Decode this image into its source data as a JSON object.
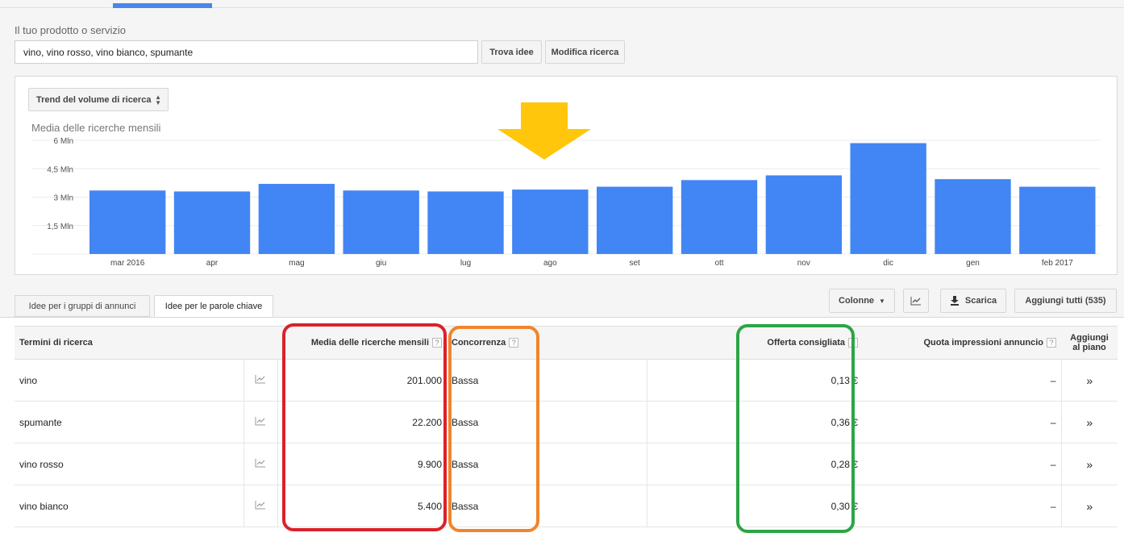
{
  "search": {
    "label": "Il tuo prodotto o servizio",
    "value": "vino, vino rosso, vino bianco, spumante",
    "find_button": "Trova idee",
    "modify_button": "Modifica ricerca"
  },
  "chart_controls": {
    "trend_select": "Trend del volume di ricerca",
    "subtitle": "Media delle ricerche mensili"
  },
  "chart_data": {
    "type": "bar",
    "title": "Media delle ricerche mensili",
    "categories": [
      "mar 2016",
      "apr",
      "mag",
      "giu",
      "lug",
      "ago",
      "set",
      "ott",
      "nov",
      "dic",
      "gen",
      "feb 2017"
    ],
    "values": [
      3.35,
      3.3,
      3.7,
      3.35,
      3.3,
      3.4,
      3.55,
      3.9,
      4.15,
      5.85,
      3.95,
      3.55
    ],
    "y_unit": "Mln",
    "y_ticks": [
      "1,5 Mln",
      "3 Mln",
      "4,5 Mln",
      "6 Mln"
    ],
    "y_tick_values": [
      1.5,
      3,
      4.5,
      6
    ],
    "ylim": [
      0,
      6
    ],
    "bar_color": "#4285f4",
    "grid": true
  },
  "annotation_arrow_color": "#ffc60b",
  "tabs": {
    "ad_groups": "Idee per i gruppi di annunci",
    "keywords": "Idee per le parole chiave"
  },
  "toolbar": {
    "columns": "Colonne",
    "download": "Scarica",
    "add_all": "Aggiungi tutti (535)"
  },
  "table": {
    "headers": {
      "term": "Termini di ricerca",
      "avg_searches": "Media delle ricerche mensili",
      "competition": "Concorrenza",
      "suggested_bid": "Offerta consigliata",
      "impression_share": "Quota impressioni annuncio",
      "add_to_plan": "Aggiungi al piano"
    },
    "help_glyph": "?",
    "add_glyph": "»",
    "rows": [
      {
        "term": "vino",
        "avg": "201.000",
        "competition": "Bassa",
        "bid": "0,13 €",
        "share": "–"
      },
      {
        "term": "spumante",
        "avg": "22.200",
        "competition": "Bassa",
        "bid": "0,36 €",
        "share": "–"
      },
      {
        "term": "vino rosso",
        "avg": "9.900",
        "competition": "Bassa",
        "bid": "0,28 €",
        "share": "–"
      },
      {
        "term": "vino bianco",
        "avg": "5.400",
        "competition": "Bassa",
        "bid": "0,30 €",
        "share": "–"
      }
    ]
  },
  "highlight_colors": {
    "avg_searches": "#d9222a",
    "competition": "#f0852d",
    "suggested_bid": "#2ca545"
  }
}
